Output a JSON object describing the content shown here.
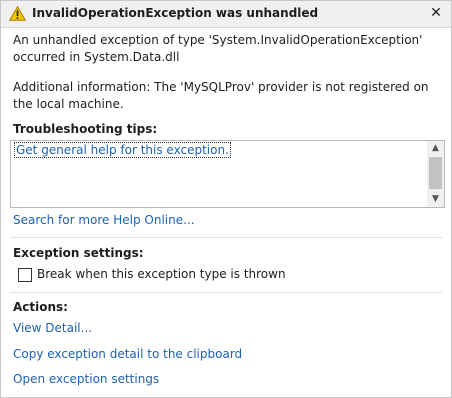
{
  "title": "InvalidOperationException was unhandled",
  "close_glyph": "✕",
  "message": "An unhandled exception of type 'System.InvalidOperationException' occurred in System.Data.dll",
  "additional_info": "Additional information: The 'MySQLProv' provider is not registered on the local machine.",
  "troubleshooting": {
    "heading": "Troubleshooting tips:",
    "tips": [
      "Get general help for this exception."
    ],
    "search_link": "Search for more Help Online..."
  },
  "exception_settings": {
    "heading": "Exception settings:",
    "checkbox_label": "Break when this exception type is thrown",
    "checked": false
  },
  "actions": {
    "heading": "Actions:",
    "items": [
      "View Detail...",
      "Copy exception detail to the clipboard",
      "Open exception settings"
    ]
  },
  "colors": {
    "link": "#1e61b0",
    "warning_fill": "#f5c400",
    "titlebar_bg": "#f0f0f0"
  },
  "icons": [
    "warning-icon",
    "close-icon",
    "scroll-up-arrow-icon",
    "scroll-down-arrow-icon"
  ]
}
